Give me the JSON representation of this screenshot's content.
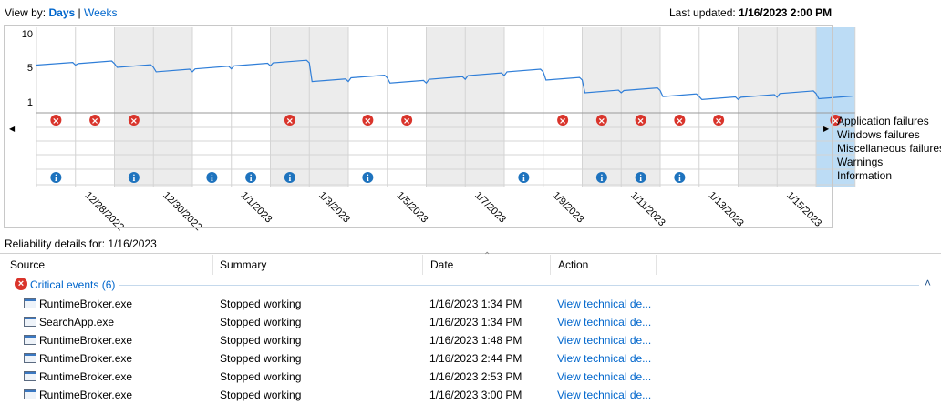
{
  "header": {
    "view_by_label": "View by:",
    "days_link": "Days",
    "separator": "|",
    "weeks_link": "Weeks",
    "last_updated_label": "Last updated:",
    "last_updated_value": "1/16/2023 2:00 PM"
  },
  "chart": {
    "y_ticks": [
      "10",
      "5",
      "1"
    ],
    "dates": [
      "12/28/2022",
      "12/30/2022",
      "1/1/2023",
      "1/3/2023",
      "1/5/2023",
      "1/7/2023",
      "1/9/2023",
      "1/11/2023",
      "1/13/2023",
      "1/15/2023"
    ],
    "legend": [
      "Application failures",
      "Windows failures",
      "Miscellaneous failures",
      "Warnings",
      "Information"
    ],
    "selected_day_label": "1/16/2023",
    "colors": {
      "line": "#2f7ed8",
      "shade": "#ececec",
      "selected": "#bcdcf5",
      "error": "#d9342b",
      "info": "#1e73be"
    }
  },
  "chart_data": {
    "type": "line",
    "title": "",
    "ylabel": "",
    "ylim": [
      1,
      10
    ],
    "x": [
      "12/27/2022",
      "12/28/2022",
      "12/29/2022",
      "12/30/2022",
      "12/31/2022",
      "1/1/2023",
      "1/2/2023",
      "1/3/2023",
      "1/4/2023",
      "1/5/2023",
      "1/6/2023",
      "1/7/2023",
      "1/8/2023",
      "1/9/2023",
      "1/10/2023",
      "1/11/2023",
      "1/12/2023",
      "1/13/2023",
      "1/14/2023",
      "1/15/2023",
      "1/16/2023"
    ],
    "series": [
      {
        "values": [
          5.8,
          6.0,
          5.5,
          4.9,
          5.3,
          5.7,
          6.1,
          3.6,
          4.1,
          3.4,
          3.9,
          4.4,
          4.9,
          3.8,
          2.1,
          2.4,
          1.6,
          1.2,
          1.5,
          2.0,
          1.3
        ]
      }
    ],
    "events": {
      "application_failures": [
        "12/27/2022",
        "12/28/2022",
        "12/29/2022",
        "1/2/2023",
        "1/4/2023",
        "1/5/2023",
        "1/9/2023",
        "1/10/2023",
        "1/11/2023",
        "1/12/2023",
        "1/13/2023",
        "1/16/2023"
      ],
      "information": [
        "12/27/2022",
        "12/29/2022",
        "12/31/2022",
        "1/1/2023",
        "1/2/2023",
        "1/4/2023",
        "1/8/2023",
        "1/10/2023",
        "1/11/2023",
        "1/12/2023"
      ]
    }
  },
  "details": {
    "title_label": "Reliability details for:",
    "title_date": "1/16/2023",
    "columns": [
      "Source",
      "Summary",
      "Date",
      "Action"
    ],
    "group_label": "Critical events (6)",
    "rows": [
      {
        "source": "RuntimeBroker.exe",
        "summary": "Stopped working",
        "date": "1/16/2023 1:34 PM",
        "action": "View technical de..."
      },
      {
        "source": "SearchApp.exe",
        "summary": "Stopped working",
        "date": "1/16/2023 1:34 PM",
        "action": "View technical de..."
      },
      {
        "source": "RuntimeBroker.exe",
        "summary": "Stopped working",
        "date": "1/16/2023 1:48 PM",
        "action": "View technical de..."
      },
      {
        "source": "RuntimeBroker.exe",
        "summary": "Stopped working",
        "date": "1/16/2023 2:44 PM",
        "action": "View technical de..."
      },
      {
        "source": "RuntimeBroker.exe",
        "summary": "Stopped working",
        "date": "1/16/2023 2:53 PM",
        "action": "View technical de..."
      },
      {
        "source": "RuntimeBroker.exe",
        "summary": "Stopped working",
        "date": "1/16/2023 3:00 PM",
        "action": "View technical de..."
      }
    ]
  }
}
